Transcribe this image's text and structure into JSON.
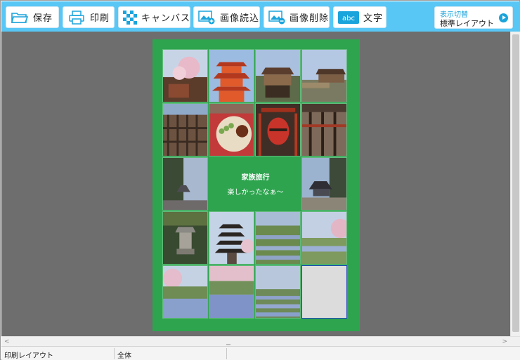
{
  "toolbar": {
    "save": "保存",
    "print": "印刷",
    "canvas": "キャンバス",
    "image_load": "画像読込",
    "image_delete": "画像削除",
    "text": "文字"
  },
  "display_switch": {
    "title": "表示切替",
    "mode": "標準レイアウト"
  },
  "page": {
    "title": "家族旅行",
    "subtitle": "楽しかったなぁ～"
  },
  "colors": {
    "toolbar": "#58c7f5",
    "accent": "#1aa4dc",
    "page_background": "#2ea44f",
    "work_background": "#6e6e6e"
  },
  "statusbar": {
    "layout": "印刷レイアウト",
    "zoom": "全体"
  }
}
